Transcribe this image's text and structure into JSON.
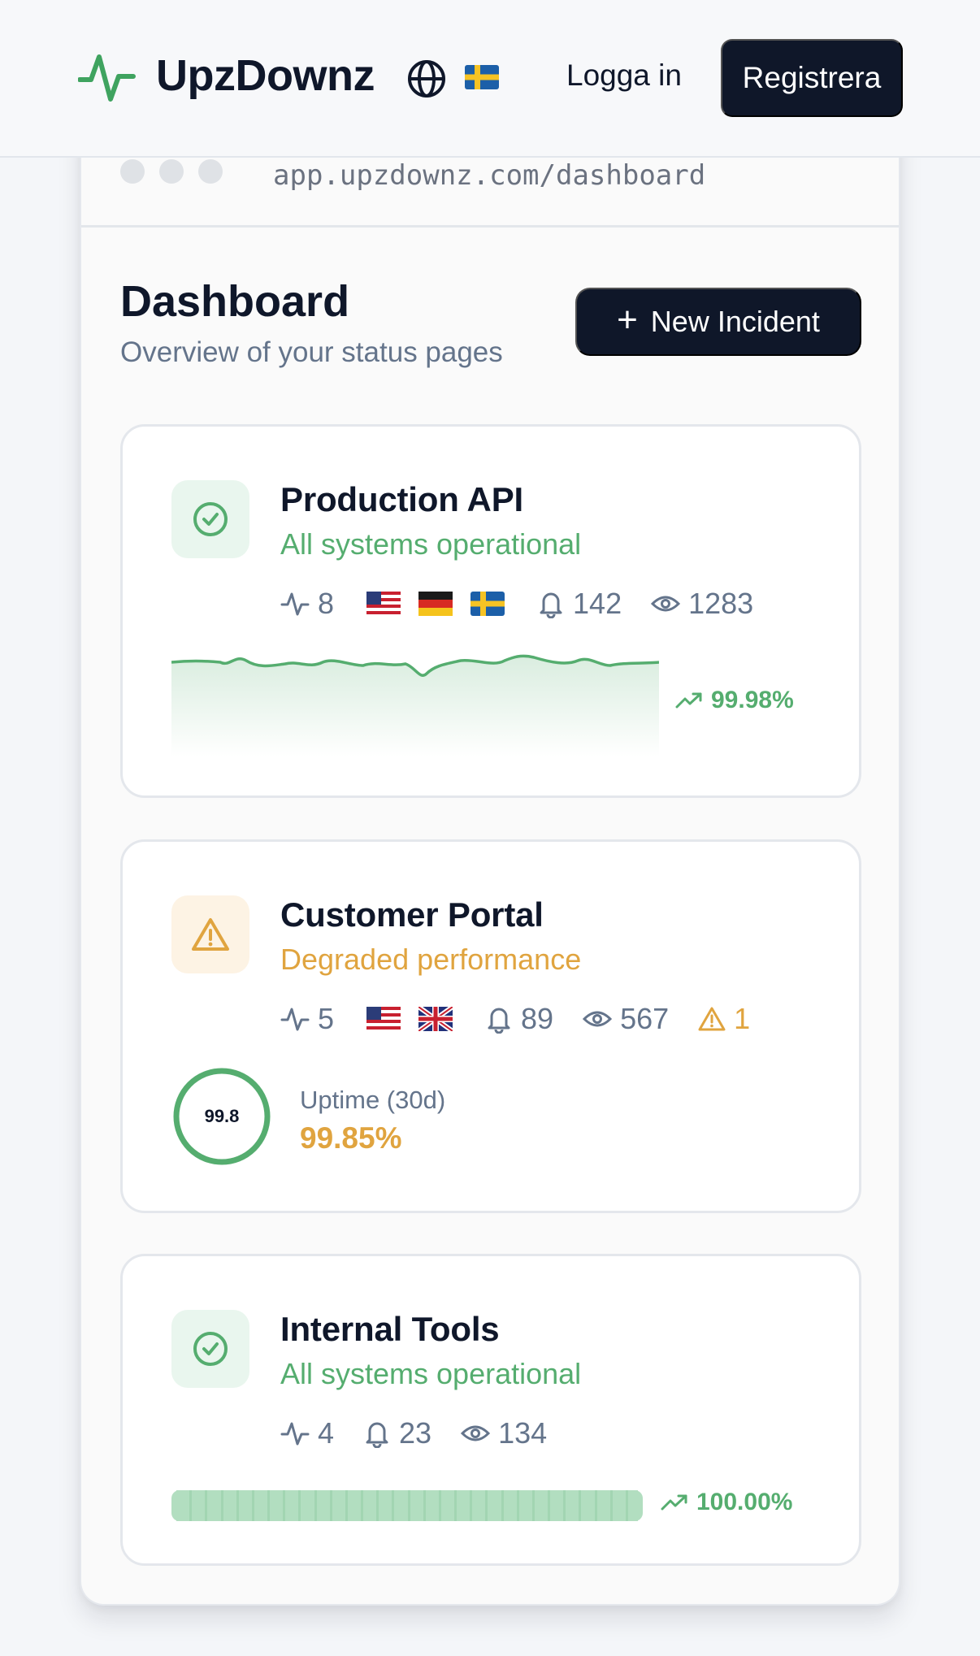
{
  "header": {
    "brand": "UpzDownz",
    "login_label": "Logga in",
    "register_label": "Registrera",
    "language_flag": "sweden-flag",
    "globe_icon": "globe-icon",
    "logo_icon": "pulse-icon",
    "accent_color": "#3fa35f"
  },
  "browser": {
    "url": "app.upzdownz.com/dashboard"
  },
  "dashboard": {
    "title": "Dashboard",
    "subtitle": "Overview of your status pages",
    "new_incident_label": "New Incident"
  },
  "cards": [
    {
      "title": "Production API",
      "status": "All systems operational",
      "status_color": "#55ad6f",
      "icon": "check-circle-icon",
      "monitors": "8",
      "regions": [
        "us-flag",
        "de-flag",
        "se-flag"
      ],
      "subscribers": "142",
      "views": "1283",
      "uptime": "99.98%"
    },
    {
      "title": "Customer Portal",
      "status": "Degraded performance",
      "status_color": "#e0a43f",
      "icon": "warning-triangle-icon",
      "monitors": "5",
      "regions": [
        "us-flag",
        "uk-flag"
      ],
      "subscribers": "89",
      "views": "567",
      "warnings": "1",
      "ring_value": "99.8",
      "ring_fraction": 0.998,
      "uptime_label": "Uptime (30d)",
      "uptime": "99.85%"
    },
    {
      "title": "Internal Tools",
      "status": "All systems operational",
      "status_color": "#55ad6f",
      "icon": "check-circle-icon",
      "monitors": "4",
      "subscribers": "23",
      "views": "134",
      "uptime": "100.00%",
      "uptime_fraction": 1.0
    }
  ]
}
